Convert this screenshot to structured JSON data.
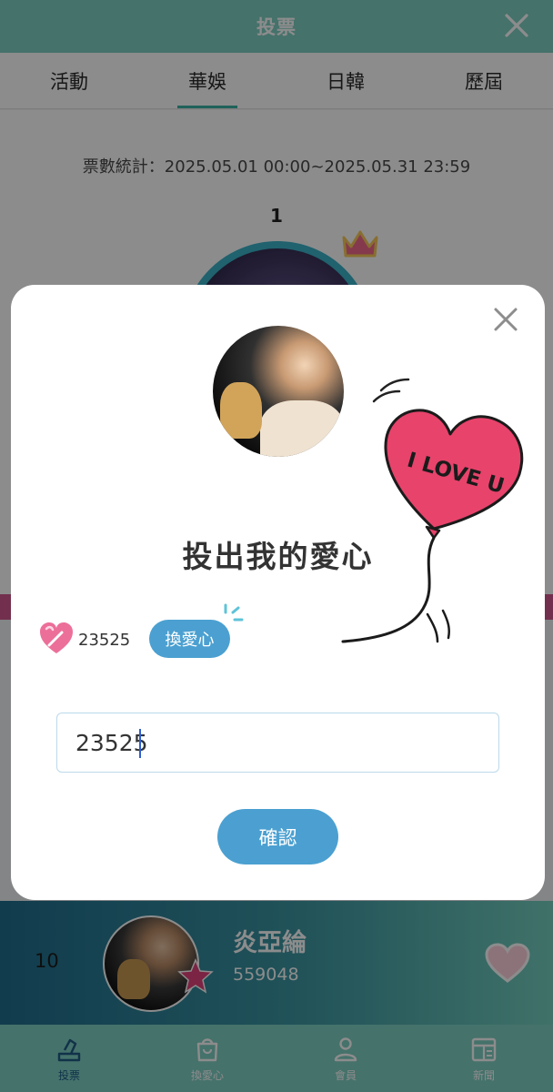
{
  "header": {
    "title": "投票"
  },
  "tabs": [
    {
      "label": "活動"
    },
    {
      "label": "華娛"
    },
    {
      "label": "日韓"
    },
    {
      "label": "歷屆"
    }
  ],
  "active_tab": "華娛",
  "stats": {
    "text": "票數統計：2025.05.01 00:00~2025.05.31 23:59"
  },
  "top_rank": {
    "number": "1"
  },
  "ranking_row": {
    "rank": "10",
    "name": "炎亞綸",
    "votes": "559048"
  },
  "dialog": {
    "title": "投出我的愛心",
    "balloon_text": "I LOVE U",
    "heart_balance": "23525",
    "exchange_label": "換愛心",
    "input_value": "23525",
    "confirm_label": "確認"
  },
  "bottom_nav": [
    {
      "label": "投票",
      "icon": "vote-icon"
    },
    {
      "label": "換愛心",
      "icon": "bag-icon"
    },
    {
      "label": "會員",
      "icon": "user-icon"
    },
    {
      "label": "新聞",
      "icon": "news-icon"
    }
  ],
  "colors": {
    "header": "#7ecfc3",
    "accent_blue": "#4ba0d1",
    "balloon_pink": "#e8436b",
    "tab_underline": "#3ab3a6"
  }
}
